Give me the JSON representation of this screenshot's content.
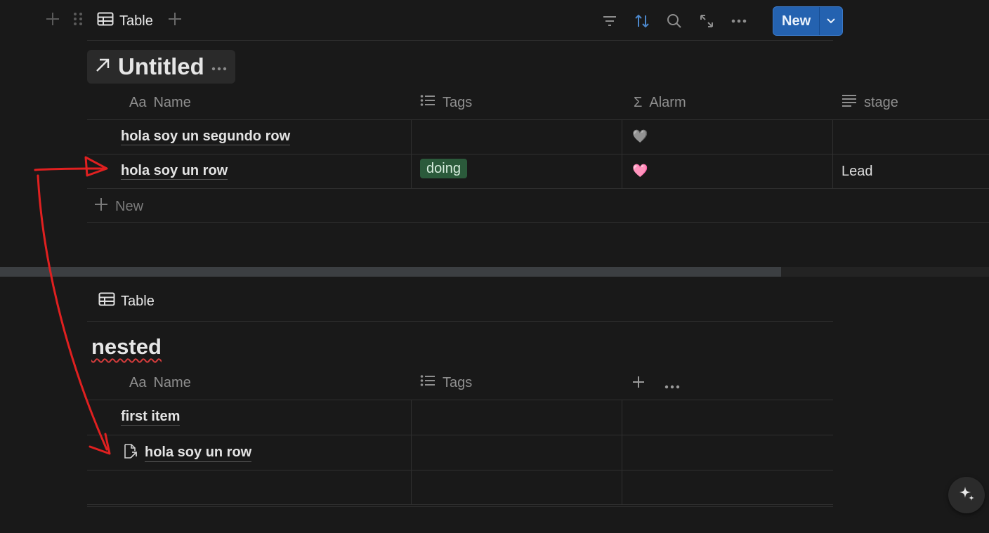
{
  "toolbar": {
    "view_label": "Table",
    "new_label": "New",
    "icons": [
      "add-icon",
      "drag-handle-icon",
      "table-icon",
      "add-view-icon",
      "filter-icon",
      "sort-icon",
      "search-icon",
      "expand-icon",
      "more-icon",
      "chevron-down-icon"
    ]
  },
  "linked_db": {
    "title": "Untitled",
    "columns": [
      {
        "icon": "Aa",
        "label": "Name"
      },
      {
        "icon": "list-icon",
        "label": "Tags"
      },
      {
        "icon": "Σ",
        "label": "Alarm"
      },
      {
        "icon": "text-icon",
        "label": "stage"
      }
    ],
    "rows": [
      {
        "name": "hola soy un segundo row",
        "tag": "",
        "alarm": "🩶",
        "stage": ""
      },
      {
        "name": "hola soy un row",
        "tag": "doing",
        "alarm": "🩷",
        "stage": "Lead"
      }
    ],
    "new_label": "New"
  },
  "nested_db": {
    "view_label": "Table",
    "title": "nested",
    "columns": [
      {
        "icon": "Aa",
        "label": "Name"
      },
      {
        "icon": "list-icon",
        "label": "Tags"
      }
    ],
    "rows": [
      {
        "name": "first item"
      },
      {
        "name": "hola soy un row"
      }
    ]
  },
  "colors": {
    "background": "#191919",
    "accent": "#2462b0",
    "tag_doing": "#2b5a3b",
    "annotation": "#e02020"
  }
}
